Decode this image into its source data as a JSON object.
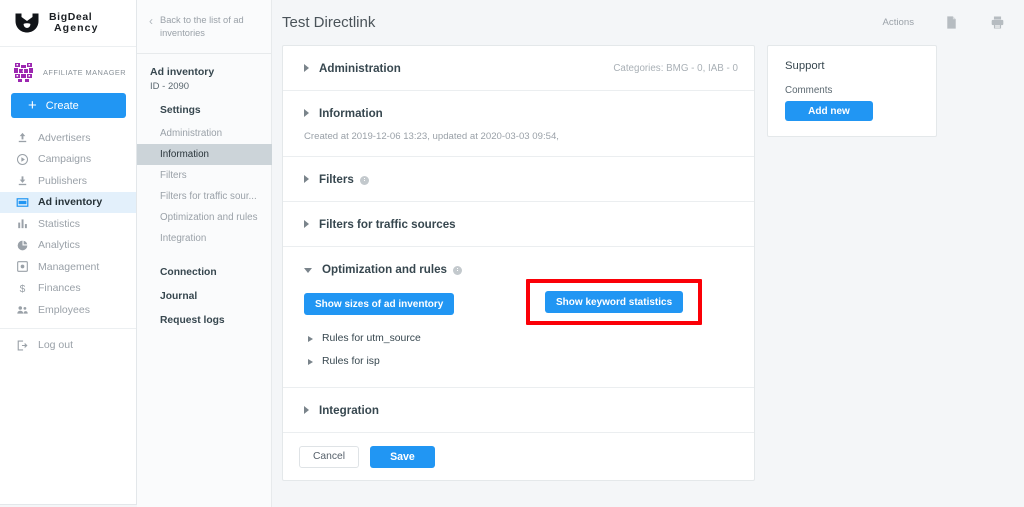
{
  "brand": {
    "name_line1": "BigDeal",
    "name_line2": "Agency",
    "logo_icon": "bull-shield-logo"
  },
  "account": {
    "label": "AFFILIATE MANAGER",
    "avatar_icon": "identicon-avatar",
    "avatar_color": "#9c27b0"
  },
  "sidebar": {
    "create_label": "Create",
    "create_color": "#2196f3",
    "items": [
      {
        "label": "Advertisers",
        "icon": "upload-icon",
        "active": false
      },
      {
        "label": "Campaigns",
        "icon": "play-circle-icon",
        "active": false
      },
      {
        "label": "Publishers",
        "icon": "download-icon",
        "active": false
      },
      {
        "label": "Ad inventory",
        "icon": "window-icon",
        "active": true
      },
      {
        "label": "Statistics",
        "icon": "bar-chart-icon",
        "active": false
      },
      {
        "label": "Analytics",
        "icon": "pie-chart-icon",
        "active": false
      },
      {
        "label": "Management",
        "icon": "frame-icon",
        "active": false
      },
      {
        "label": "Finances",
        "icon": "dollar-icon",
        "active": false
      },
      {
        "label": "Employees",
        "icon": "people-icon",
        "active": false
      }
    ],
    "logout": {
      "label": "Log out",
      "icon": "logout-icon"
    }
  },
  "subnav": {
    "back_label": "Back to the list of ad inventories",
    "back_icon": "chevron-left-icon",
    "entity_title": "Ad inventory",
    "entity_id": "ID - 2090",
    "settings_header": "Settings",
    "settings_items": [
      {
        "label": "Administration",
        "active": false
      },
      {
        "label": "Information",
        "active": true
      },
      {
        "label": "Filters",
        "active": false
      },
      {
        "label": "Filters for traffic sour...",
        "active": false
      },
      {
        "label": "Optimization and rules",
        "active": false
      },
      {
        "label": "Integration",
        "active": false
      }
    ],
    "links": [
      {
        "label": "Connection"
      },
      {
        "label": "Journal"
      },
      {
        "label": "Request logs"
      }
    ]
  },
  "topbar": {
    "title": "Test Directlink",
    "actions_label": "Actions",
    "doc_icon": "document-icon",
    "print_icon": "printer-icon"
  },
  "card": {
    "administration": {
      "title": "Administration",
      "categories": "Categories: BMG - 0, IAB - 0",
      "expanded": false
    },
    "information": {
      "title": "Information",
      "created_text": "Created at 2019-12-06 13:23, updated at 2020-03-03 09:54,",
      "expanded": false
    },
    "filters": {
      "title": "Filters",
      "has_info": true,
      "expanded": false
    },
    "filters_traffic": {
      "title": "Filters for traffic sources",
      "has_info": false,
      "expanded": false
    },
    "optimization": {
      "title": "Optimization and rules",
      "has_info": true,
      "expanded": true,
      "show_sizes_label": "Show sizes of ad inventory",
      "show_keyword_label": "Show keyword statistics",
      "highlight_color": "#fb0007",
      "rules": [
        {
          "label": "Rules for utm_source"
        },
        {
          "label": "Rules for isp"
        }
      ]
    },
    "integration": {
      "title": "Integration",
      "expanded": false
    },
    "footer": {
      "cancel_label": "Cancel",
      "save_label": "Save"
    }
  },
  "support": {
    "title": "Support",
    "comments_label": "Comments",
    "add_new_label": "Add new"
  }
}
